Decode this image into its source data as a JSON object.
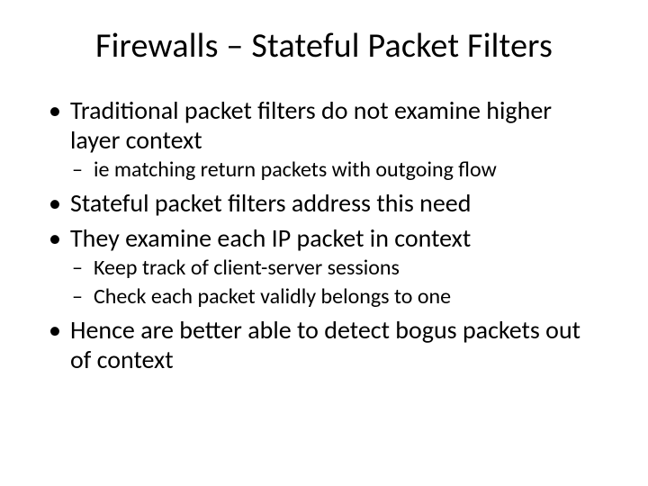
{
  "title": "Firewalls – Stateful Packet Filters",
  "bullets": [
    {
      "text": "Traditional packet filters do not examine higher layer context",
      "sub": [
        "ie matching return packets with outgoing flow"
      ]
    },
    {
      "text": "Stateful packet filters address this need",
      "sub": []
    },
    {
      "text": "They examine each IP packet in context",
      "sub": [
        "Keep track of client-server sessions",
        "Check each packet validly belongs to one"
      ]
    },
    {
      "text": "Hence are better able to detect bogus packets out of context",
      "sub": []
    }
  ]
}
